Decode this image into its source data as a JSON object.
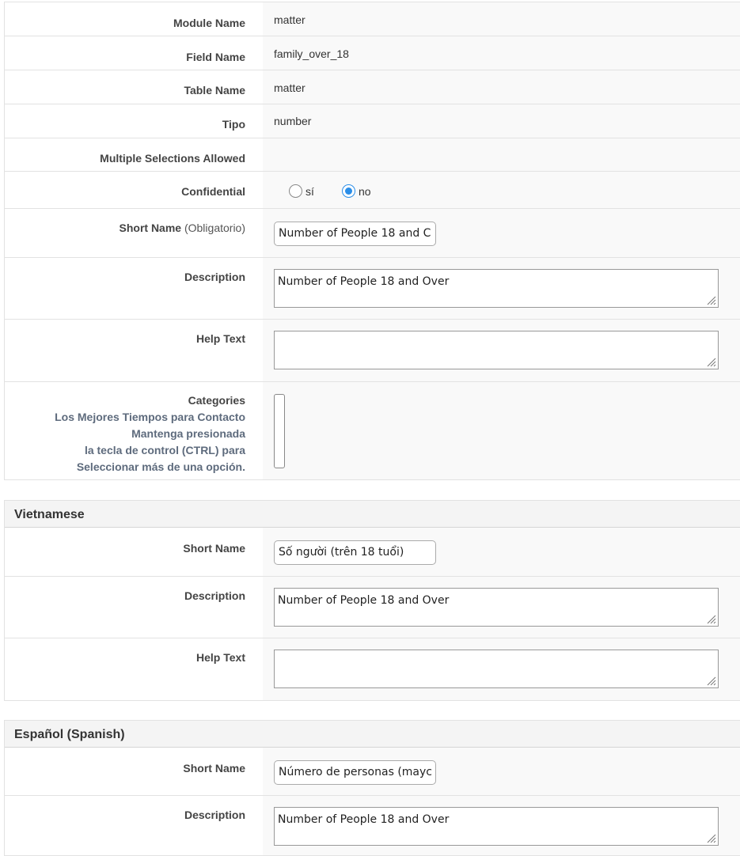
{
  "main": {
    "module_name": {
      "label": "Module Name",
      "value": "matter"
    },
    "field_name": {
      "label": "Field Name",
      "value": "family_over_18"
    },
    "table_name": {
      "label": "Table Name",
      "value": "matter"
    },
    "tipo": {
      "label": "Tipo",
      "value": "number"
    },
    "multiple": {
      "label": "Multiple Selections Allowed",
      "value": ""
    },
    "confidential": {
      "label": "Confidential",
      "options": [
        "sí",
        "no"
      ],
      "selected": "no"
    },
    "short_name": {
      "label": "Short Name",
      "required": "(Obligatorio)",
      "value": "Number of People 18 and C"
    },
    "description": {
      "label": "Description",
      "value": "Number of People 18 and Over"
    },
    "help_text": {
      "label": "Help Text",
      "value": ""
    },
    "categories": {
      "label": "Categories",
      "help": [
        "Los Mejores Tiempos para Contacto",
        "Mantenga presionada",
        "la tecla de control (CTRL) para",
        "Seleccionar más de una opción."
      ]
    }
  },
  "vietnamese": {
    "title": "Vietnamese",
    "short_name": {
      "label": "Short Name",
      "value": "Số người (trên 18 tuổi)"
    },
    "description": {
      "label": "Description",
      "value": "Number of People 18 and Over"
    },
    "help_text": {
      "label": "Help Text",
      "value": ""
    }
  },
  "spanish": {
    "title": "Español (Spanish)",
    "short_name": {
      "label": "Short Name",
      "value": "Número de personas (mayc"
    },
    "description": {
      "label": "Description",
      "value": "Number of People 18 and Over"
    }
  },
  "colors": {
    "radio_accent": "#2b8ee8",
    "help_text_color": "#5e6b7d"
  }
}
